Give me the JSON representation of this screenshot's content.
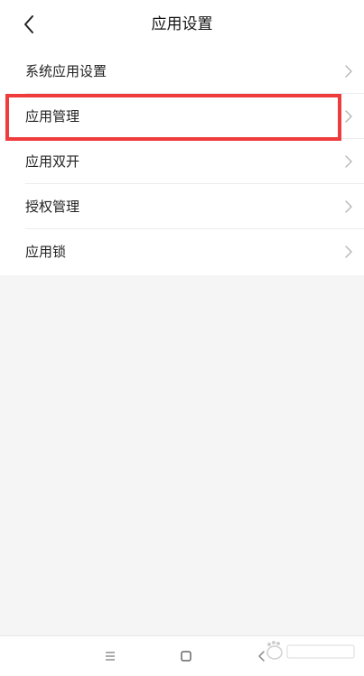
{
  "header": {
    "title": "应用设置",
    "back_icon": "chevron-left-icon"
  },
  "settings_list": {
    "items": [
      {
        "label": "系统应用设置",
        "icon": "chevron-right-icon"
      },
      {
        "label": "应用管理",
        "icon": "chevron-right-icon",
        "highlighted": true
      },
      {
        "label": "应用双开",
        "icon": "chevron-right-icon"
      },
      {
        "label": "授权管理",
        "icon": "chevron-right-icon"
      },
      {
        "label": "应用锁",
        "icon": "chevron-right-icon"
      }
    ]
  },
  "navigation_bar": {
    "buttons": [
      {
        "icon": "menu-icon"
      },
      {
        "icon": "home-square-icon"
      },
      {
        "icon": "back-icon"
      }
    ]
  },
  "colors": {
    "highlight": "#ef3b3b",
    "background": "#f5f5f5",
    "surface": "#ffffff"
  }
}
